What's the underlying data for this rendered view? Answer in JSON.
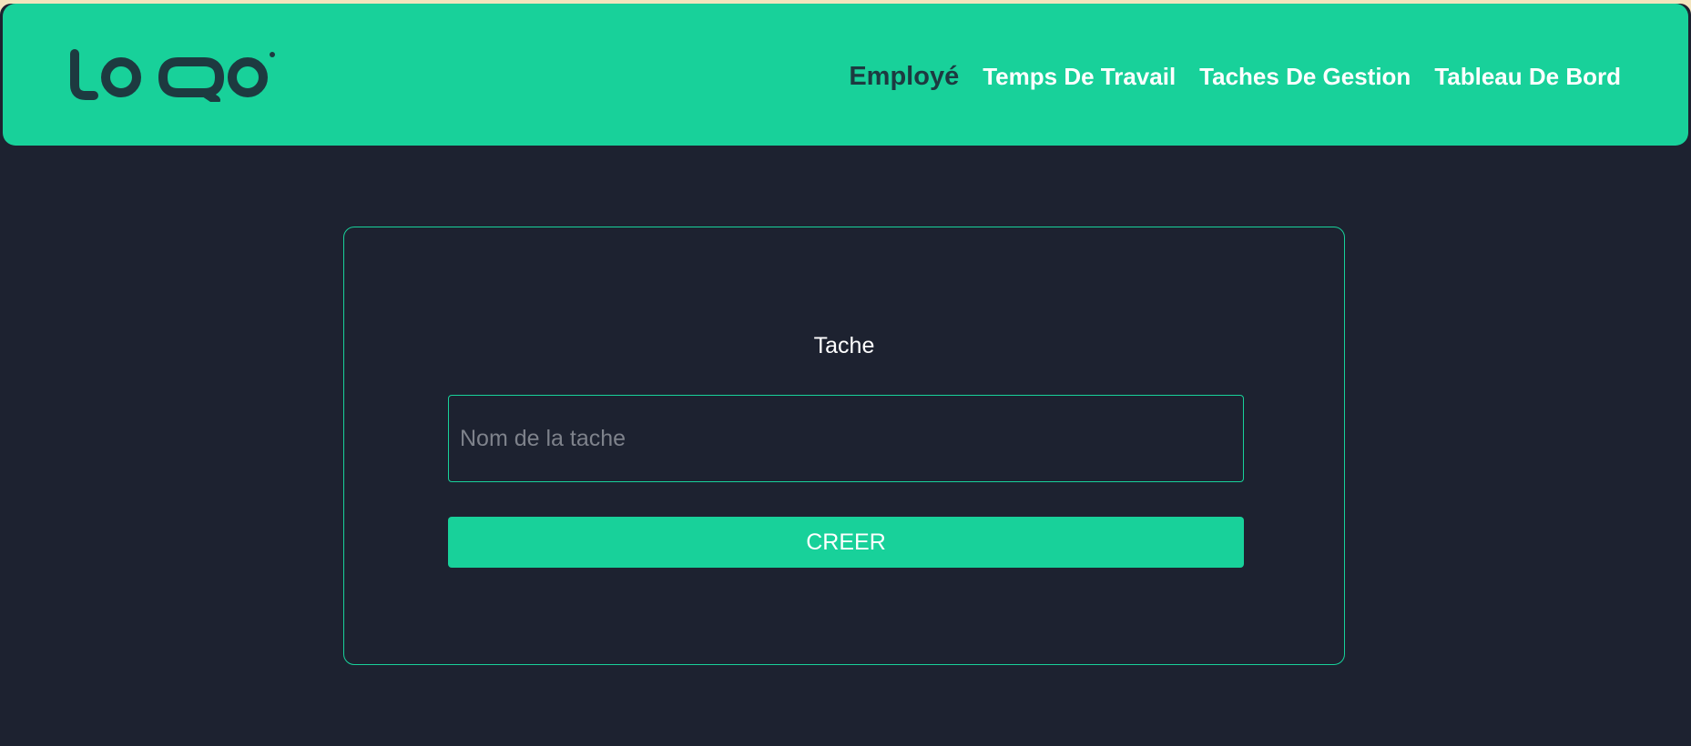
{
  "brand": {
    "logo_text": "LOQO",
    "accent_color": "#18d19a",
    "logo_color": "#1d3a40"
  },
  "nav": {
    "items": [
      {
        "label": "Employé",
        "active": true
      },
      {
        "label": "Temps De Travail",
        "active": false
      },
      {
        "label": "Taches De Gestion",
        "active": false
      },
      {
        "label": "Tableau De Bord",
        "active": false
      }
    ]
  },
  "form": {
    "title": "Tache",
    "task_name": {
      "value": "",
      "placeholder": "Nom de la tache"
    },
    "submit_label": "CREER"
  },
  "colors": {
    "background": "#1d2230",
    "accent": "#18d19a",
    "text": "#ffffff"
  }
}
